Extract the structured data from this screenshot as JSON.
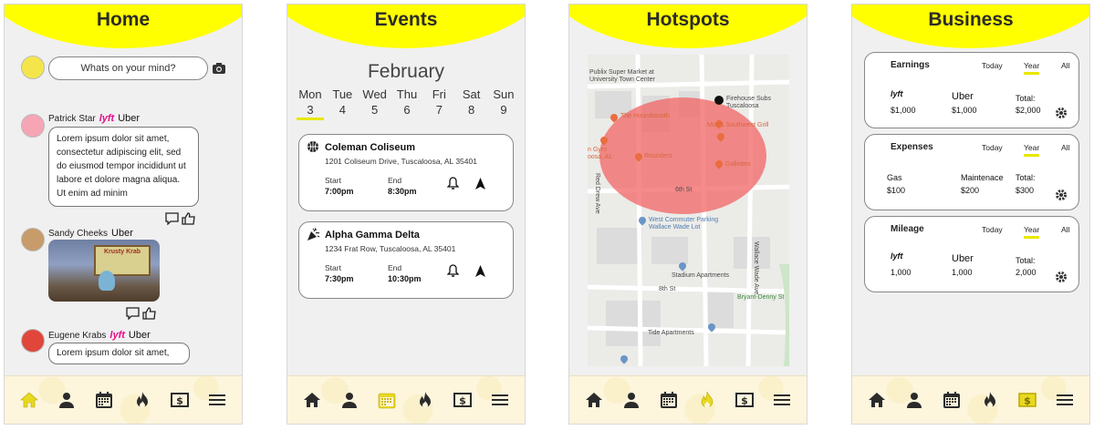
{
  "screens": {
    "home": {
      "title": "Home",
      "compose_placeholder": "Whats on your mind?",
      "posts": [
        {
          "author": "Patrick Star",
          "badges": [
            "lyft",
            "Uber"
          ],
          "text": "Lorem ipsum dolor sit amet, consectetur adipiscing elit, sed do eiusmod tempor incididunt ut labore et dolore magna aliqua. Ut enim ad minim"
        },
        {
          "author": "Sandy Cheeks",
          "badges": [
            "Uber"
          ],
          "image_sign": "Krusty Krab"
        },
        {
          "author": "Eugene Krabs",
          "badges": [
            "lyft",
            "Uber"
          ],
          "text": "Lorem ipsum dolor sit amet,"
        }
      ]
    },
    "events": {
      "title": "Events",
      "month": "February",
      "days": [
        {
          "name": "Mon",
          "date": "3",
          "selected": true
        },
        {
          "name": "Tue",
          "date": "4"
        },
        {
          "name": "Wed",
          "date": "5"
        },
        {
          "name": "Thu",
          "date": "6"
        },
        {
          "name": "Fri",
          "date": "7"
        },
        {
          "name": "Sat",
          "date": "8"
        },
        {
          "name": "Sun",
          "date": "9"
        }
      ],
      "cards": [
        {
          "icon": "basketball-icon",
          "title": "Coleman Coliseum",
          "address": "1201 Coliseum Drive, Tuscaloosa, AL 35401",
          "start_label": "Start",
          "start": "7:00pm",
          "end_label": "End",
          "end": "8:30pm"
        },
        {
          "icon": "party-popper-icon",
          "title": "Alpha Gamma Delta",
          "address": "1234 Frat Row, Tuscaloosa, AL 35401",
          "start_label": "Start",
          "start": "7:30pm",
          "end_label": "End",
          "end": "10:30pm"
        }
      ]
    },
    "hotspots": {
      "title": "Hotspots",
      "map_labels": {
        "publix": "Publix Super Market at\nUniversity Town Center",
        "houndstooth": "The Houndstooth",
        "firehouse": "Firehouse Subs\nTuscaloosa",
        "moes": "Moe's Southwest Grill",
        "gyro": "n Gyro\noosa, AL",
        "rounders": "Rounders",
        "gallettes": "Gallettes",
        "west_commuter": "West Commuter Parking\nWallace Wade Lot",
        "stadium": "Stadium Apartments",
        "bryant": "Bryant-Denny St",
        "tide": "Tide Apartments",
        "street_8th": "8th St",
        "street_6th": "6th St",
        "street_red_drew": "Red Drew Ave",
        "street_wallace": "Wallace Wade Ave"
      }
    },
    "business": {
      "title": "Business",
      "cards": [
        {
          "title": "Earnings",
          "tabs": [
            "Today",
            "Year",
            "All"
          ],
          "active_tab": "Year",
          "cols": [
            {
              "label": "lyft",
              "value": "$1,000"
            },
            {
              "label": "Uber",
              "value": "$1,000"
            },
            {
              "label": "Total:",
              "value": "$2,000"
            }
          ]
        },
        {
          "title": "Expenses",
          "tabs": [
            "Today",
            "Year",
            "All"
          ],
          "active_tab": "Year",
          "cols": [
            {
              "label": "Gas",
              "value": "$100"
            },
            {
              "label": "Maintenace",
              "value": "$200"
            },
            {
              "label": "Total:",
              "value": "$300"
            }
          ]
        },
        {
          "title": "Mileage",
          "tabs": [
            "Today",
            "Year",
            "All"
          ],
          "active_tab": "Year",
          "cols": [
            {
              "label": "lyft",
              "value": "1,000"
            },
            {
              "label": "Uber",
              "value": "1,000"
            },
            {
              "label": "Total:",
              "value": "2,000"
            }
          ]
        }
      ]
    }
  },
  "nav_items": [
    "home-icon",
    "profile-icon",
    "calendar-icon",
    "flame-icon",
    "money-icon",
    "menu-icon"
  ],
  "colors": {
    "accent": "#ffff00",
    "active_nav": "#e8d820",
    "background": "#f0f0f0",
    "hotspot": "#f26464",
    "lyft": "#ea0b8c"
  }
}
